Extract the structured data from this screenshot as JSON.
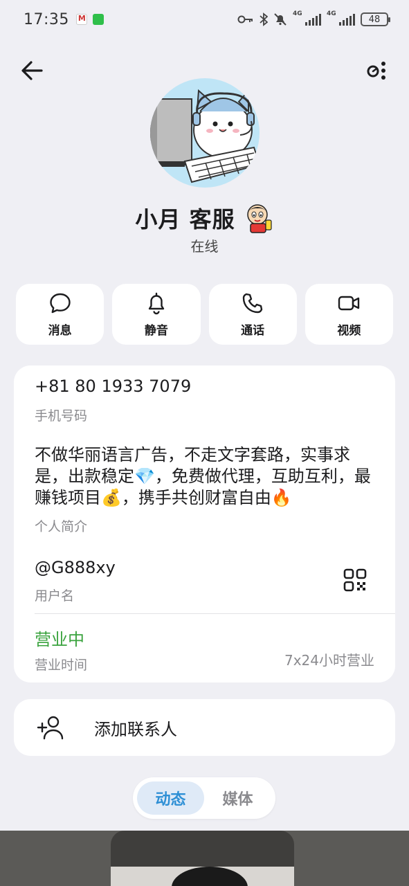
{
  "status_bar": {
    "time": "17:35",
    "battery": "48",
    "network_1": "4G",
    "network_2": "4G"
  },
  "header": {
    "back_icon": "arrow-left-icon",
    "more_icon": "more-vertical-icon"
  },
  "profile": {
    "name": "小月 客服",
    "online_status": "在线"
  },
  "actions": [
    {
      "label": "消息",
      "icon": "message-icon"
    },
    {
      "label": "静音",
      "icon": "bell-icon"
    },
    {
      "label": "通话",
      "icon": "phone-icon"
    },
    {
      "label": "视频",
      "icon": "video-icon"
    }
  ],
  "info": {
    "phone": "+81 80 1933 7079",
    "phone_label": "手机号码",
    "bio": "不做华丽语言广告，不走文字套路，实事求是，出款稳定💎，免费做代理，互助互利，最赚钱项目💰，携手共创财富自由🔥",
    "bio_label": "个人简介",
    "username": "@G888xy",
    "username_label": "用户名",
    "hours_status": "营业中",
    "hours_label": "营业时间",
    "hours_value": "7x24小时营业"
  },
  "add_contact": {
    "label": "添加联系人"
  },
  "tabs": [
    {
      "label": "动态",
      "active": true
    },
    {
      "label": "媒体",
      "active": false
    }
  ],
  "colors": {
    "background": "#efeff4",
    "accent": "#2d8fd5",
    "open_status": "#3aa33e"
  }
}
